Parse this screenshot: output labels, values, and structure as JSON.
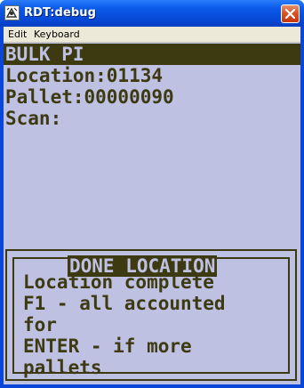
{
  "window": {
    "title": "RDT:debug",
    "icons": {
      "app": "rdt-app-icon",
      "close": "close-icon"
    },
    "colors": {
      "titlebar": "#0648d6",
      "close_button": "#d8542b"
    }
  },
  "menu": {
    "items": [
      "Edit",
      "Keyboard"
    ]
  },
  "terminal": {
    "colors": {
      "background": "#bfc1e3",
      "text": "#3d3a12"
    },
    "header": "BULK PI",
    "fields": {
      "location": "Location:01134",
      "pallet": "Pallet:00000090",
      "scan": "Scan:"
    },
    "dialog": {
      "title": "DONE LOCATION",
      "lines": [
        "Location complete",
        "F1 - all accounted",
        "for",
        "ENTER - if more",
        "pallets"
      ]
    }
  }
}
